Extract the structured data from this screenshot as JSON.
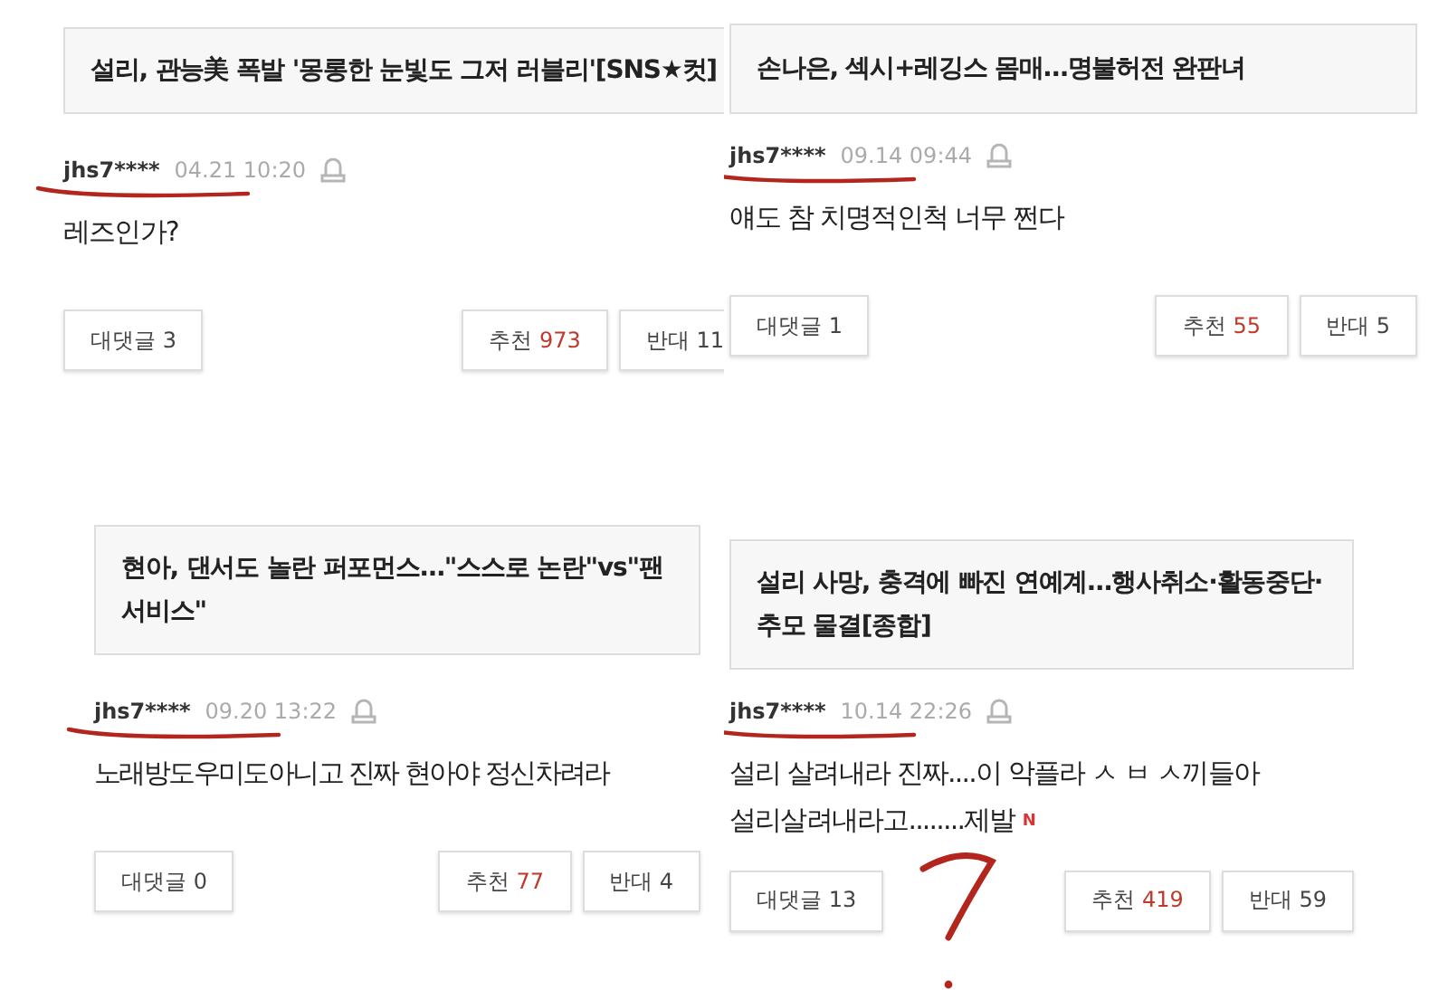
{
  "panels": [
    {
      "headline": "설리, 관능美 폭발 '몽롱한 눈빛도 그저 러블리'[SNS★컷]",
      "author": "jhs7****",
      "time": "04.21 10:20",
      "comment": "레즈인가?",
      "replies_button": "대댓글 3",
      "like_label": "추천",
      "like_count": "973",
      "dislike_button": "반대 11"
    },
    {
      "headline": "손나은, 섹시+레깅스 몸매…명불허전 완판녀",
      "author": "jhs7****",
      "time": "09.14 09:44",
      "comment": "얘도 참 치명적인척 너무 쩐다",
      "replies_button": "대댓글 1",
      "like_label": "추천",
      "like_count": "55",
      "dislike_button": "반대 5"
    },
    {
      "headline": "현아, 댄서도 놀란 퍼포먼스…\"스스로 논란\"vs\"팬서비스\"",
      "author": "jhs7****",
      "time": "09.20 13:22",
      "comment": "노래방도우미도아니고 진짜 현아야 정신차려라",
      "replies_button": "대댓글 0",
      "like_label": "추천",
      "like_count": "77",
      "dislike_button": "반대 4"
    },
    {
      "headline": "설리 사망, 충격에 빠진 연예계…행사취소·활동중단·추모 물결[종합]",
      "author": "jhs7****",
      "time": "10.14 22:26",
      "comment": "설리 살려내라 진짜....이 악플라 ㅅ ㅂ ㅅ끼들아\n설리살려내라고........제발",
      "new_badge": "N",
      "replies_button": "대댓글 13",
      "like_label": "추천",
      "like_count": "419",
      "dislike_button": "반대 59"
    }
  ]
}
